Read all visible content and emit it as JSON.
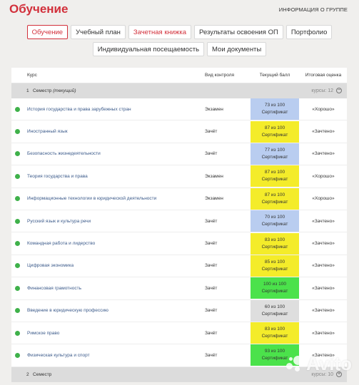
{
  "header": {
    "title": "Обучение",
    "group_link": "ИНФОРМАЦИЯ О ГРУППЕ"
  },
  "tabs_row1": [
    {
      "label": "Обучение",
      "state": "active"
    },
    {
      "label": "Учебный план",
      "state": "normal"
    },
    {
      "label": "Зачетная книжка",
      "state": "red"
    },
    {
      "label": "Результаты освоения ОП",
      "state": "normal"
    },
    {
      "label": "Портфолио",
      "state": "normal"
    }
  ],
  "tabs_row2": [
    {
      "label": "Индивидуальная посещаемость",
      "state": "normal"
    },
    {
      "label": "Мои документы",
      "state": "normal"
    }
  ],
  "table": {
    "headers": {
      "course": "Курс",
      "control": "Вид контроля",
      "score": "Текущий балл",
      "final": "Итоговая оценка"
    },
    "semester1": {
      "number": "1",
      "label": "Семестр",
      "note": "(текущий)",
      "count": "курсы: 12"
    },
    "semester2": {
      "number": "2",
      "label": "Семестр",
      "count": "курсы: 10"
    },
    "rows": [
      {
        "course": "История государства и права зарубежных стран",
        "control": "Экзамен",
        "score": "73 из 100",
        "cert": "Сертификат",
        "final": "«Хорошо»",
        "color": "#b9cdf0"
      },
      {
        "course": "Иностранный язык",
        "control": "Зачёт",
        "score": "87 из 100",
        "cert": "Сертификат",
        "final": "«Зачтено»",
        "color": "#f4ec2a"
      },
      {
        "course": "Безопасность жизнедеятельности",
        "control": "Зачёт",
        "score": "77 из 100",
        "cert": "Сертификат",
        "final": "«Зачтено»",
        "color": "#b9cdf0"
      },
      {
        "course": "Теория государства и права",
        "control": "Экзамен",
        "score": "87 из 100",
        "cert": "Сертификат",
        "final": "«Хорошо»",
        "color": "#f4ec2a"
      },
      {
        "course": "Информационные технологии в юридической деятельности",
        "control": "Экзамен",
        "score": "87 из 100",
        "cert": "Сертификат",
        "final": "«Хорошо»",
        "color": "#f4ec2a"
      },
      {
        "course": "Русский язык и культура речи",
        "control": "Зачёт",
        "score": "70 из 100",
        "cert": "Сертификат",
        "final": "«Зачтено»",
        "color": "#b9cdf0"
      },
      {
        "course": "Командная работа и лидерство",
        "control": "Зачёт",
        "score": "83 из 100",
        "cert": "Сертификат",
        "final": "«Зачтено»",
        "color": "#f4ec2a"
      },
      {
        "course": "Цифровая экономика",
        "control": "Зачёт",
        "score": "85 из 100",
        "cert": "Сертификат",
        "final": "«Зачтено»",
        "color": "#f4ec2a"
      },
      {
        "course": "Финансовая грамотность",
        "control": "Зачёт",
        "score": "100 из 100",
        "cert": "Сертификат",
        "final": "«Зачтено»",
        "color": "#4be24b"
      },
      {
        "course": "Введение в юридическую профессию",
        "control": "Зачёт",
        "score": "60 из 100",
        "cert": "Сертификат",
        "final": "«Зачтено»",
        "color": "#dedede"
      },
      {
        "course": "Римское право",
        "control": "Зачёт",
        "score": "83 из 100",
        "cert": "Сертификат",
        "final": "«Зачтено»",
        "color": "#f4ec2a"
      },
      {
        "course": "Физическая культура и спорт",
        "control": "Зачёт",
        "score": "93 из 100",
        "cert": "Сертификат",
        "final": "«Зачтено»",
        "color": "#4be24b"
      }
    ]
  },
  "watermark": {
    "text": "Avito"
  }
}
